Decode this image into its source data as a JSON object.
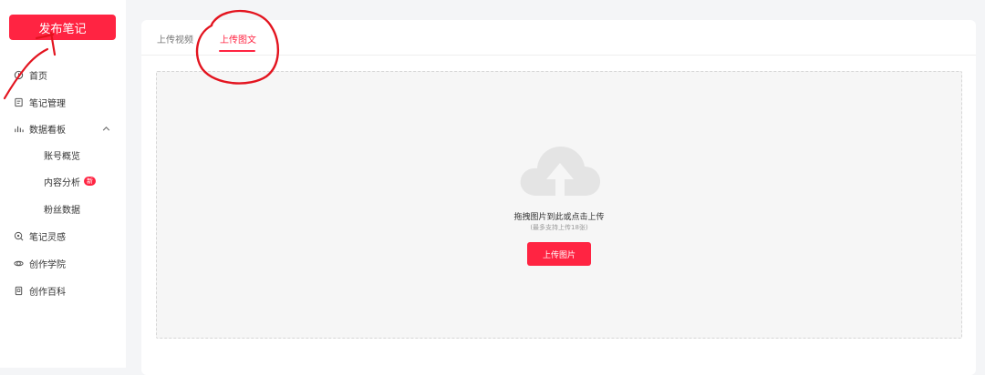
{
  "sidebar": {
    "publish_label": "发布笔记",
    "items": [
      {
        "label": "首页",
        "icon": "home-icon"
      },
      {
        "label": "笔记管理",
        "icon": "note-icon"
      },
      {
        "label": "数据看板",
        "icon": "chart-icon",
        "expanded": true
      },
      {
        "label": "笔记灵感",
        "icon": "inspiration-icon"
      },
      {
        "label": "创作学院",
        "icon": "academy-icon"
      },
      {
        "label": "创作百科",
        "icon": "wiki-icon"
      }
    ],
    "sub_items": [
      {
        "label": "账号概览"
      },
      {
        "label": "内容分析",
        "badge": "新"
      },
      {
        "label": "粉丝数据"
      }
    ]
  },
  "main": {
    "tabs": [
      {
        "label": "上传视频",
        "active": false
      },
      {
        "label": "上传图文",
        "active": true
      }
    ],
    "dropzone": {
      "title": "拖拽图片到此或点击上传",
      "hint": "(最多支持上传18张)",
      "button_label": "上传图片"
    }
  },
  "colors": {
    "accent": "#ff2442",
    "annotation": "#e3141f",
    "page_bg": "#f4f5f7"
  }
}
